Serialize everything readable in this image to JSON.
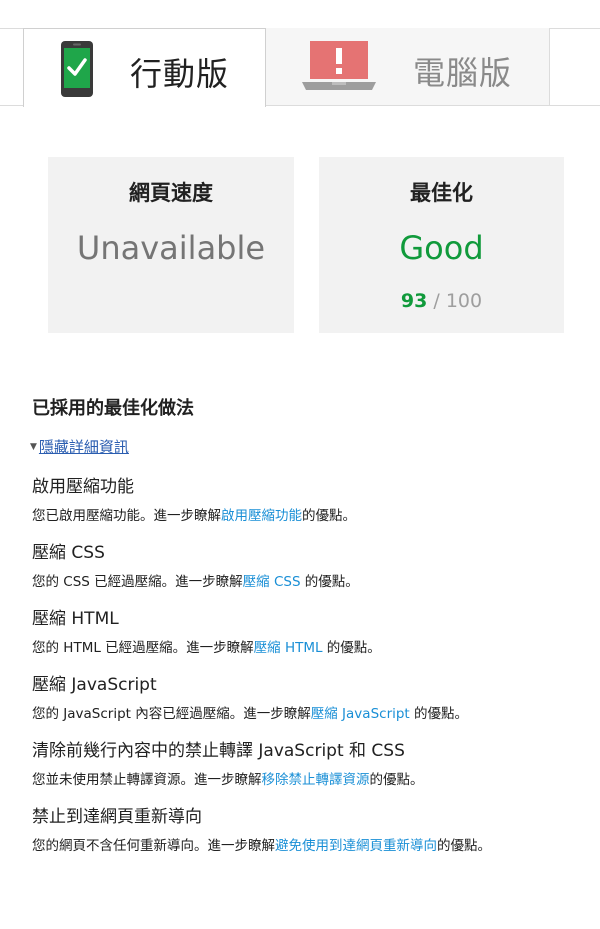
{
  "tabs": {
    "mobile_label": "行動版",
    "desktop_label": "電腦版"
  },
  "cards": {
    "speed": {
      "title": "網頁速度",
      "value": "Unavailable"
    },
    "optimization": {
      "title": "最佳化",
      "value": "Good",
      "score": "93",
      "score_separator": " / ",
      "score_max": "100"
    }
  },
  "colors": {
    "good": "#109a3b",
    "link": "#1a8fd6",
    "card_bg": "#f2f2f2"
  },
  "rules_section": {
    "title": "已採用的最佳化做法",
    "toggle_label": "隱藏詳細資訊",
    "rules": [
      {
        "title": "啟用壓縮功能",
        "pre": "您已啟用壓縮功能。進一步瞭解",
        "link": "啟用壓縮功能",
        "post": "的優點。"
      },
      {
        "title": "壓縮 CSS",
        "pre": "您的 CSS 已經過壓縮。進一步瞭解",
        "link": "壓縮 CSS",
        "post": " 的優點。"
      },
      {
        "title": "壓縮 HTML",
        "pre": "您的 HTML 已經過壓縮。進一步瞭解",
        "link": "壓縮 HTML",
        "post": " 的優點。"
      },
      {
        "title": "壓縮 JavaScript",
        "pre": "您的 JavaScript 內容已經過壓縮。進一步瞭解",
        "link": "壓縮 JavaScript",
        "post": " 的優點。"
      },
      {
        "title": "清除前幾行內容中的禁止轉譯 JavaScript 和 CSS",
        "pre": "您並未使用禁止轉譯資源。進一步瞭解",
        "link": "移除禁止轉譯資源",
        "post": "的優點。"
      },
      {
        "title": "禁止到達網頁重新導向",
        "pre": "您的網頁不含任何重新導向。進一步瞭解",
        "link": "避免使用到達網頁重新導向",
        "post": "的優點。"
      }
    ]
  }
}
